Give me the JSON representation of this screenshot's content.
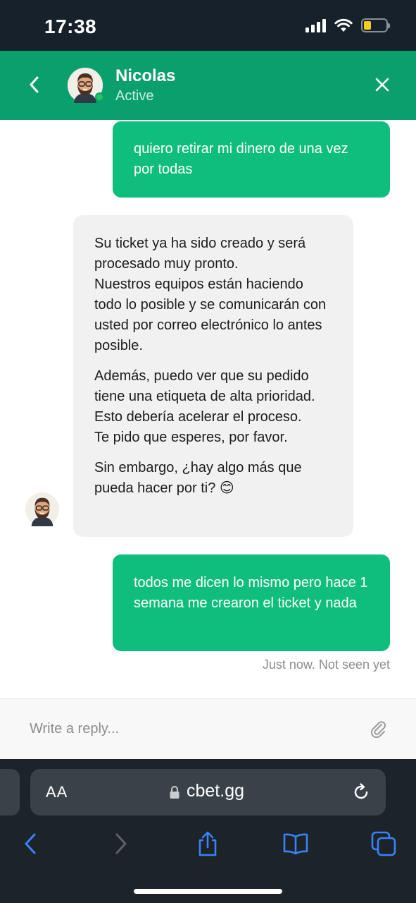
{
  "status_bar": {
    "time": "17:38"
  },
  "chat": {
    "agent_name": "Nicolas",
    "agent_status": "Active",
    "messages": [
      {
        "from": "user",
        "text": "quiero retirar mi dinero de una vez por todas"
      },
      {
        "from": "agent",
        "paragraphs": [
          "Su ticket ya ha sido creado y será procesado muy pronto.\nNuestros equipos están haciendo todo lo posible y se comunicarán con usted por correo electrónico lo antes posible.",
          "Además, puedo ver que su pedido tiene una etiqueta de alta prioridad.\nEsto debería acelerar el proceso.\nTe pido que esperes, por favor.",
          "Sin embargo, ¿hay algo más que pueda hacer por ti? 😊"
        ]
      },
      {
        "from": "user",
        "text": "todos me dicen lo mismo pero hace 1 semana me crearon el ticket y nada"
      }
    ],
    "last_message_meta": "Just now. Not seen yet"
  },
  "composer": {
    "placeholder": "Write a reply..."
  },
  "browser": {
    "text_size_label": "AA",
    "url": "cbet.gg"
  },
  "colors": {
    "header_green": "#0b9f6e",
    "bubble_green": "#0fbe7c",
    "bubble_gray": "#f1f1f2",
    "ios_blue": "#3b82f6"
  }
}
